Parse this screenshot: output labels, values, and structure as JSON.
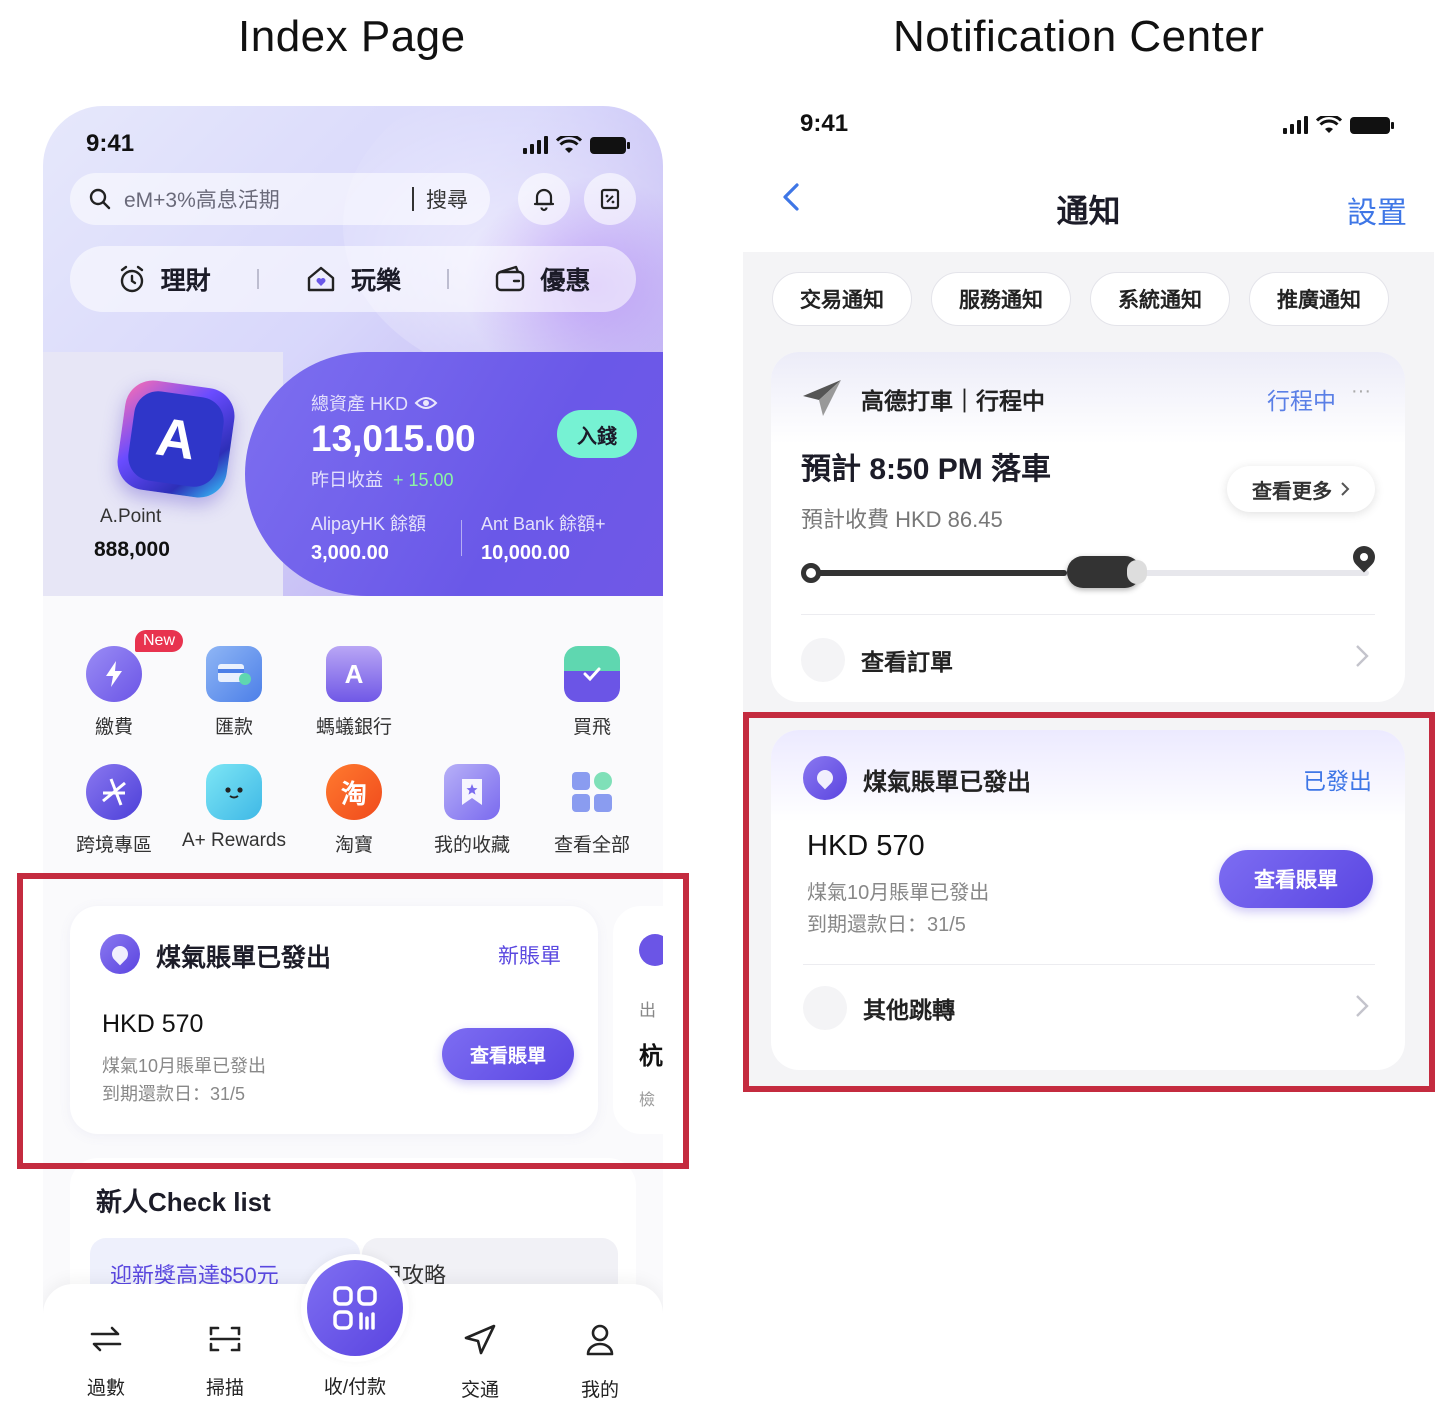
{
  "captions": {
    "left": "Index Page",
    "right": "Notification Center"
  },
  "colors": {
    "accent": "#6a58e8",
    "highlight": "#c42b3f",
    "link_blue": "#3e76e6",
    "deposit": "#76f2d3",
    "gain_green": "#8cf5a4"
  },
  "index": {
    "status": {
      "time": "9:41"
    },
    "search": {
      "placeholder": "eM+3%高息活期",
      "button": "搜尋"
    },
    "tabs": [
      {
        "label": "理財",
        "icon": "alarm-clock-icon"
      },
      {
        "label": "玩樂",
        "icon": "house-heart-icon"
      },
      {
        "label": "優惠",
        "icon": "wallet-icon"
      }
    ],
    "apoint": {
      "label": "A.Point",
      "value": "888,000"
    },
    "assets": {
      "label": "總資產 HKD",
      "value": "13,015.00",
      "yesterday_label": "昨日收益",
      "yesterday_value": "+ 15.00",
      "deposit": "入錢",
      "alipay_label": "AlipayHK 餘額",
      "alipay_value": "3,000.00",
      "antbank_label": "Ant Bank 餘額+",
      "antbank_value": "10,000.00"
    },
    "grid": [
      {
        "label": "繳費",
        "icon": "lightning-bill-icon",
        "badge": "New"
      },
      {
        "label": "匯款",
        "icon": "card-transfer-icon"
      },
      {
        "label": "螞蟻銀行",
        "icon": "ant-bank-icon"
      },
      {
        "label": "買飛",
        "icon": "ticket-icon"
      },
      {
        "label": "跨境專區",
        "icon": "globe-icon"
      },
      {
        "label": "A+ Rewards",
        "icon": "mascot-icon"
      },
      {
        "label": "淘寶",
        "icon": "taobao-icon",
        "glyph": "淘"
      },
      {
        "label": "我的收藏",
        "icon": "bookmark-star-icon"
      },
      {
        "label": "查看全部",
        "icon": "apps-grid-icon"
      }
    ],
    "bill_card": {
      "title": "煤氣賬單已發出",
      "tag": "新賬單",
      "amount": "HKD 570",
      "desc": "煤氣10月賬單已發出",
      "due": "到期還款日：31/5",
      "button": "查看賬單"
    },
    "peek_card": {
      "line1": "出",
      "line2": "杭",
      "line3": "檢"
    },
    "checklist": {
      "title": "新人Check list",
      "promo1": "迎新獎高達$50元",
      "promo2": "用攻略"
    },
    "nav": [
      {
        "label": "過數",
        "icon": "transfer-arrows-icon"
      },
      {
        "label": "掃描",
        "icon": "scan-icon"
      },
      {
        "label": "收/付款",
        "icon": "qr-pay-icon"
      },
      {
        "label": "交通",
        "icon": "navigation-icon"
      },
      {
        "label": "我的",
        "icon": "user-icon"
      }
    ]
  },
  "notify": {
    "status": {
      "time": "9:41"
    },
    "title": "通知",
    "settings": "設置",
    "chips": [
      "交易通知",
      "服務通知",
      "系統通知",
      "推廣通知"
    ],
    "trip": {
      "title": "高德打車｜行程中",
      "status": "行程中",
      "more_dots": "···",
      "main": "預計 8:50 PM 落車",
      "fee": "預計收費 HKD 86.45",
      "more_button": "查看更多",
      "progress": 0.46,
      "link": "查看訂單"
    },
    "bill": {
      "title": "煤氣賬單已發出",
      "status": "已發出",
      "amount": "HKD 570",
      "desc": "煤氣10月賬單已發出",
      "due": "到期還款日：31/5",
      "button": "查看賬單",
      "link": "其他跳轉"
    }
  }
}
